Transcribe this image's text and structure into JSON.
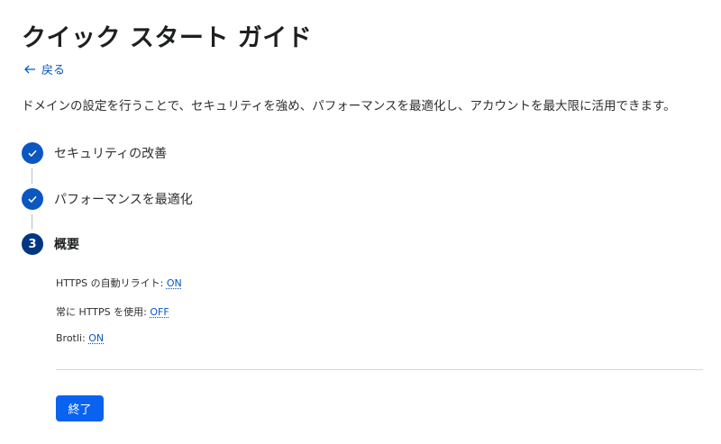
{
  "page": {
    "title": "クイック スタート ガイド",
    "back_label": "戻る",
    "description": "ドメインの設定を行うことで、セキュリティを強め、パフォーマンスを最適化し、アカウントを最大限に活用できます。"
  },
  "steps": [
    {
      "label": "セキュリティの改善",
      "state": "done",
      "icon": "check-icon"
    },
    {
      "label": "パフォーマンスを最適化",
      "state": "done",
      "icon": "check-icon"
    },
    {
      "number": "3",
      "label": "概要",
      "state": "current"
    }
  ],
  "summary": [
    {
      "label": "HTTPS の自動リライト: ",
      "value": "ON"
    },
    {
      "label": "常に HTTPS を使用: ",
      "value": "OFF"
    },
    {
      "label": "Brotli: ",
      "value": "ON"
    }
  ],
  "actions": {
    "finish_label": "終了"
  },
  "colors": {
    "accent": "#0a56c2",
    "current_step": "#003682",
    "button": "#0a63f0"
  }
}
